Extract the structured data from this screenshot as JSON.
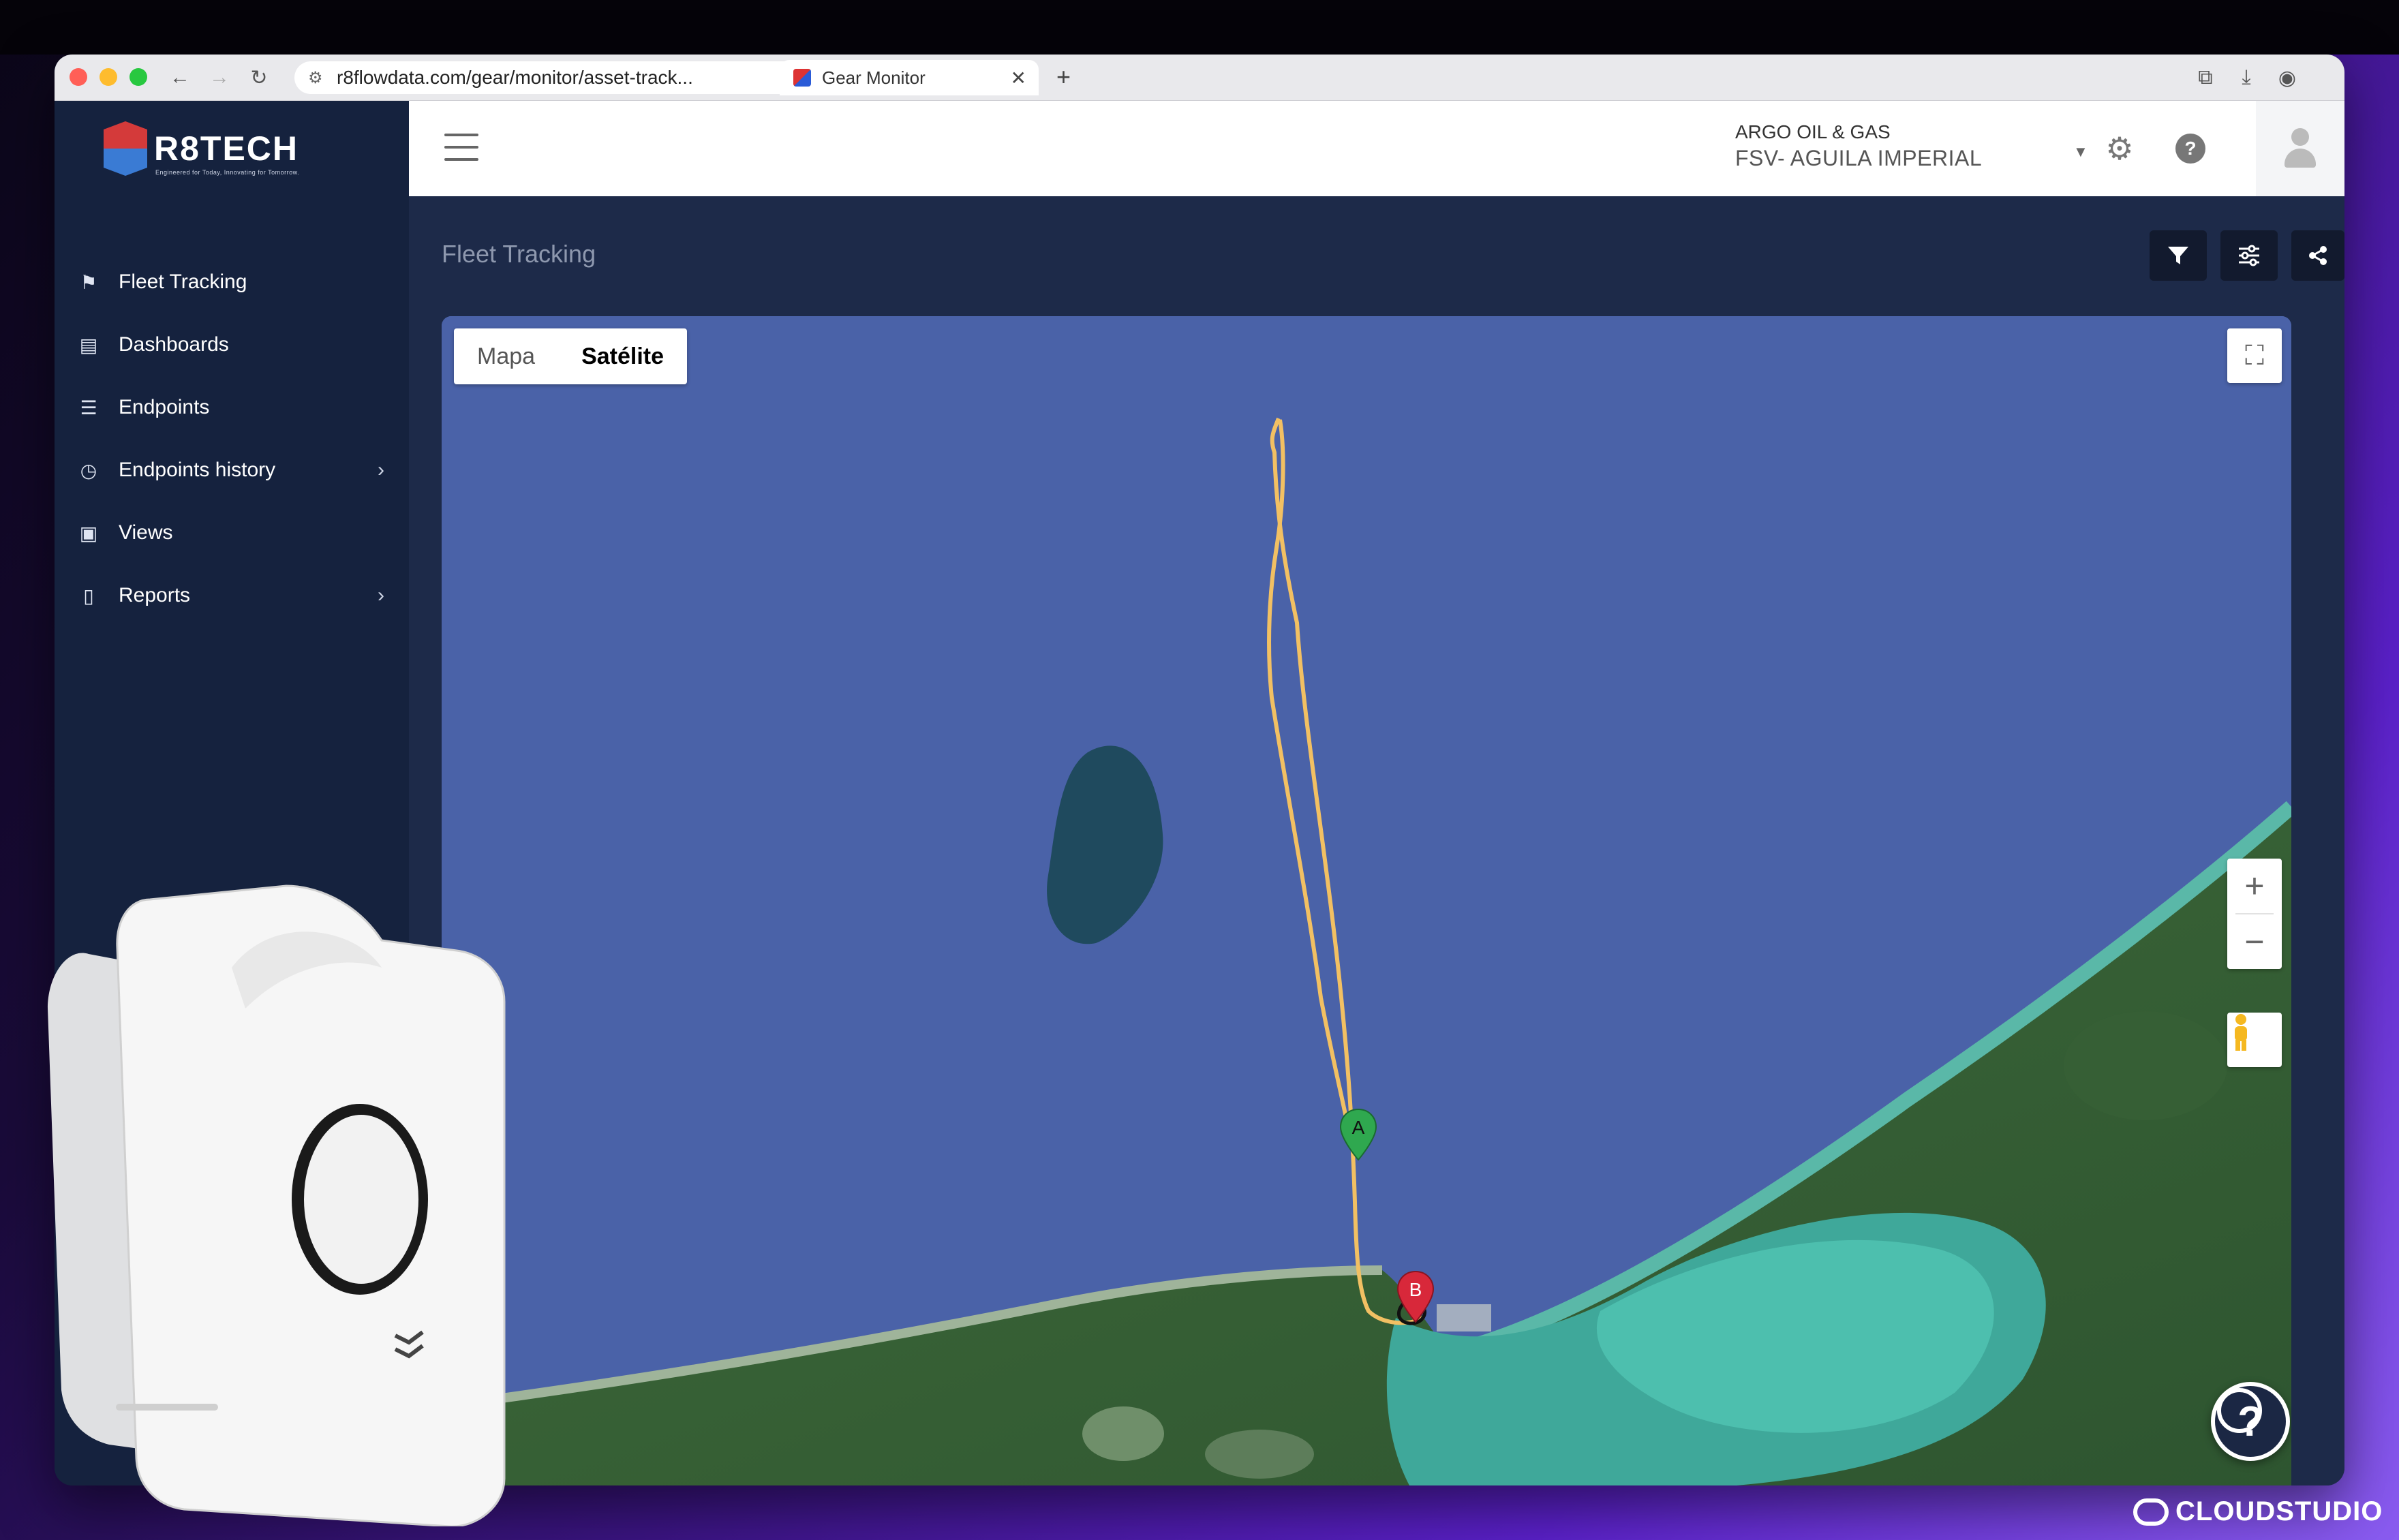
{
  "browser": {
    "url": "r8flowdata.com/gear/monitor/asset-track...",
    "tab_title": "Gear Monitor"
  },
  "sidebar": {
    "logo_text": "R8TECH",
    "logo_tagline": "Engineered for Today, Innovating for Tomorrow.",
    "items": [
      {
        "label": "Fleet Tracking",
        "icon": "map-marker-icon"
      },
      {
        "label": "Dashboards",
        "icon": "bar-chart-icon"
      },
      {
        "label": "Endpoints",
        "icon": "list-icon"
      },
      {
        "label": "Endpoints history",
        "icon": "clock-icon"
      },
      {
        "label": "Views",
        "icon": "gallery-icon"
      },
      {
        "label": "Reports",
        "icon": "file-icon"
      }
    ]
  },
  "topbar": {
    "company": "ARGO OIL & GAS",
    "vessel": "FSV- AGUILA IMPERIAL"
  },
  "main": {
    "page_title": "Fleet Tracking"
  },
  "map": {
    "type_options": [
      "Mapa",
      "Satélite"
    ],
    "selected_type": "Satélite",
    "markers": [
      {
        "label": "A",
        "color": "#2fa84f"
      },
      {
        "label": "B",
        "color": "#d8283a"
      }
    ],
    "route_color": "#f2c063",
    "help_label": "?"
  },
  "watermark": {
    "brand": "CLOUDSTUDIO"
  }
}
